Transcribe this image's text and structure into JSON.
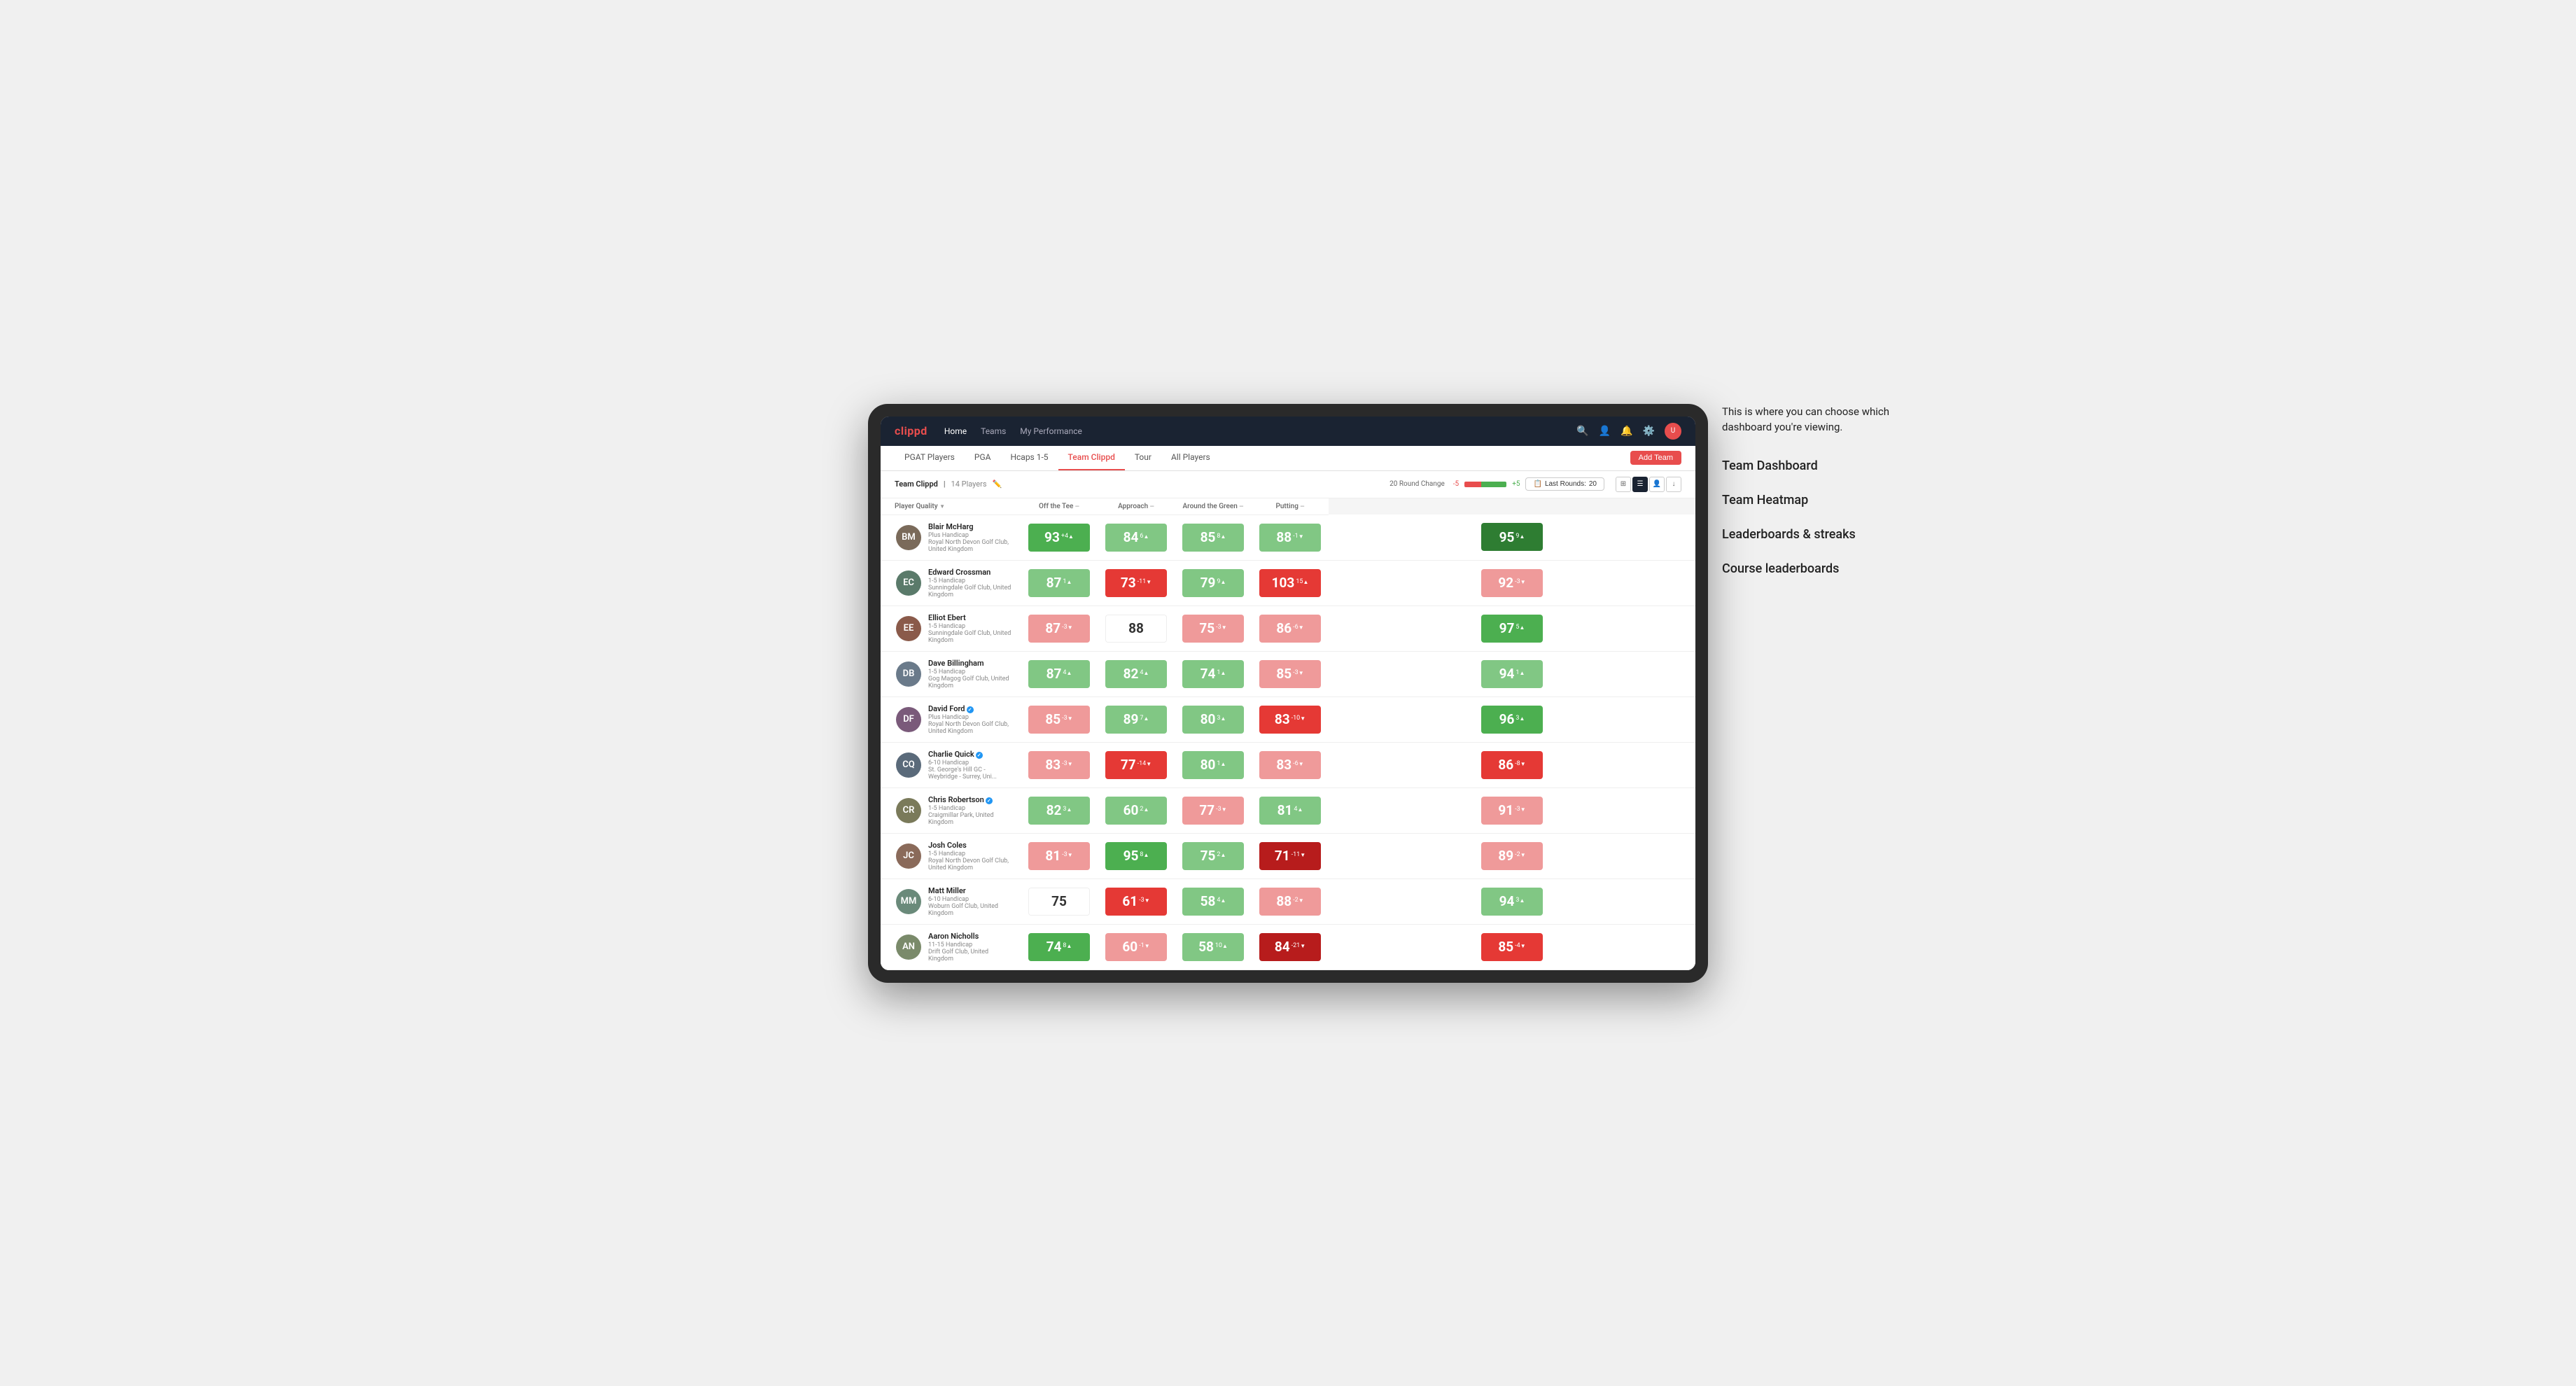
{
  "annotation": {
    "intro": "This is where you can choose which dashboard you're viewing.",
    "items": [
      "Team Dashboard",
      "Team Heatmap",
      "Leaderboards & streaks",
      "Course leaderboards"
    ]
  },
  "topnav": {
    "logo": "clippd",
    "links": [
      "Home",
      "Teams",
      "My Performance"
    ]
  },
  "subnav": {
    "links": [
      "PGAT Players",
      "PGA",
      "Hcaps 1-5",
      "Team Clippd",
      "Tour",
      "All Players"
    ],
    "active": "Team Clippd",
    "add_team_label": "Add Team"
  },
  "team_header": {
    "name": "Team Clippd",
    "count": "14 Players",
    "round_change_label": "20 Round Change",
    "rc_neg": "-5",
    "rc_pos": "+5",
    "last_rounds_label": "Last Rounds:",
    "last_rounds_value": "20"
  },
  "table": {
    "columns": [
      {
        "label": "Player Quality",
        "key": "player_quality"
      },
      {
        "label": "Off the Tee",
        "key": "off_tee"
      },
      {
        "label": "Approach",
        "key": "approach"
      },
      {
        "label": "Around the Green",
        "key": "around_green"
      },
      {
        "label": "Putting",
        "key": "putting"
      }
    ],
    "players": [
      {
        "name": "Blair McHarg",
        "handicap": "Plus Handicap",
        "club": "Royal North Devon Golf Club, United Kingdom",
        "initials": "BM",
        "avatar_color": "#7a6a5a",
        "player_quality": {
          "value": "93",
          "change": "+4",
          "dir": "up",
          "bg": "green-mid"
        },
        "off_tee": {
          "value": "84",
          "change": "6",
          "dir": "up",
          "bg": "green-light"
        },
        "approach": {
          "value": "85",
          "change": "8",
          "dir": "up",
          "bg": "green-light"
        },
        "around_green": {
          "value": "88",
          "change": "-1",
          "dir": "down",
          "bg": "green-light"
        },
        "putting": {
          "value": "95",
          "change": "9",
          "dir": "up",
          "bg": "green-dark"
        }
      },
      {
        "name": "Edward Crossman",
        "handicap": "1-5 Handicap",
        "club": "Sunningdale Golf Club, United Kingdom",
        "initials": "EC",
        "avatar_color": "#5a7a6a",
        "player_quality": {
          "value": "87",
          "change": "1",
          "dir": "up",
          "bg": "green-light"
        },
        "off_tee": {
          "value": "73",
          "change": "-11",
          "dir": "down",
          "bg": "red-mid"
        },
        "approach": {
          "value": "79",
          "change": "9",
          "dir": "up",
          "bg": "green-light"
        },
        "around_green": {
          "value": "103",
          "change": "15",
          "dir": "up",
          "bg": "red-mid"
        },
        "putting": {
          "value": "92",
          "change": "-3",
          "dir": "down",
          "bg": "red-light"
        }
      },
      {
        "name": "Elliot Ebert",
        "handicap": "1-5 Handicap",
        "club": "Sunningdale Golf Club, United Kingdom",
        "initials": "EE",
        "avatar_color": "#8a5a4a",
        "player_quality": {
          "value": "87",
          "change": "-3",
          "dir": "down",
          "bg": "red-light"
        },
        "off_tee": {
          "value": "88",
          "change": "",
          "dir": "",
          "bg": "white"
        },
        "approach": {
          "value": "75",
          "change": "-3",
          "dir": "down",
          "bg": "red-light"
        },
        "around_green": {
          "value": "86",
          "change": "-6",
          "dir": "down",
          "bg": "red-light"
        },
        "putting": {
          "value": "97",
          "change": "5",
          "dir": "up",
          "bg": "green-mid"
        }
      },
      {
        "name": "Dave Billingham",
        "handicap": "1-5 Handicap",
        "club": "Gog Magog Golf Club, United Kingdom",
        "initials": "DB",
        "avatar_color": "#6a7a8a",
        "player_quality": {
          "value": "87",
          "change": "4",
          "dir": "up",
          "bg": "green-light"
        },
        "off_tee": {
          "value": "82",
          "change": "4",
          "dir": "up",
          "bg": "green-light"
        },
        "approach": {
          "value": "74",
          "change": "1",
          "dir": "up",
          "bg": "green-light"
        },
        "around_green": {
          "value": "85",
          "change": "-3",
          "dir": "down",
          "bg": "red-light"
        },
        "putting": {
          "value": "94",
          "change": "1",
          "dir": "up",
          "bg": "green-light"
        }
      },
      {
        "name": "David Ford",
        "handicap": "Plus Handicap",
        "club": "Royal North Devon Golf Club, United Kingdom",
        "initials": "DF",
        "avatar_color": "#7a5a7a",
        "verified": true,
        "player_quality": {
          "value": "85",
          "change": "-3",
          "dir": "down",
          "bg": "red-light"
        },
        "off_tee": {
          "value": "89",
          "change": "7",
          "dir": "up",
          "bg": "green-light"
        },
        "approach": {
          "value": "80",
          "change": "3",
          "dir": "up",
          "bg": "green-light"
        },
        "around_green": {
          "value": "83",
          "change": "-10",
          "dir": "down",
          "bg": "red-mid"
        },
        "putting": {
          "value": "96",
          "change": "3",
          "dir": "up",
          "bg": "green-mid"
        }
      },
      {
        "name": "Charlie Quick",
        "handicap": "6-10 Handicap",
        "club": "St. George's Hill GC - Weybridge - Surrey, Uni...",
        "initials": "CQ",
        "avatar_color": "#5a6a7a",
        "verified": true,
        "player_quality": {
          "value": "83",
          "change": "-3",
          "dir": "down",
          "bg": "red-light"
        },
        "off_tee": {
          "value": "77",
          "change": "-14",
          "dir": "down",
          "bg": "red-mid"
        },
        "approach": {
          "value": "80",
          "change": "1",
          "dir": "up",
          "bg": "green-light"
        },
        "around_green": {
          "value": "83",
          "change": "-6",
          "dir": "down",
          "bg": "red-light"
        },
        "putting": {
          "value": "86",
          "change": "-8",
          "dir": "down",
          "bg": "red-mid"
        }
      },
      {
        "name": "Chris Robertson",
        "handicap": "1-5 Handicap",
        "club": "Craigmillar Park, United Kingdom",
        "initials": "CR",
        "avatar_color": "#7a7a5a",
        "verified": true,
        "player_quality": {
          "value": "82",
          "change": "3",
          "dir": "up",
          "bg": "green-light"
        },
        "off_tee": {
          "value": "60",
          "change": "2",
          "dir": "up",
          "bg": "green-light"
        },
        "approach": {
          "value": "77",
          "change": "-3",
          "dir": "down",
          "bg": "red-light"
        },
        "around_green": {
          "value": "81",
          "change": "4",
          "dir": "up",
          "bg": "green-light"
        },
        "putting": {
          "value": "91",
          "change": "-3",
          "dir": "down",
          "bg": "red-light"
        }
      },
      {
        "name": "Josh Coles",
        "handicap": "1-5 Handicap",
        "club": "Royal North Devon Golf Club, United Kingdom",
        "initials": "JC",
        "avatar_color": "#8a6a5a",
        "player_quality": {
          "value": "81",
          "change": "-3",
          "dir": "down",
          "bg": "red-light"
        },
        "off_tee": {
          "value": "95",
          "change": "8",
          "dir": "up",
          "bg": "green-mid"
        },
        "approach": {
          "value": "75",
          "change": "2",
          "dir": "up",
          "bg": "green-light"
        },
        "around_green": {
          "value": "71",
          "change": "-11",
          "dir": "down",
          "bg": "red-dark"
        },
        "putting": {
          "value": "89",
          "change": "-2",
          "dir": "down",
          "bg": "red-light"
        }
      },
      {
        "name": "Matt Miller",
        "handicap": "6-10 Handicap",
        "club": "Woburn Golf Club, United Kingdom",
        "initials": "MM",
        "avatar_color": "#6a8a7a",
        "player_quality": {
          "value": "75",
          "change": "",
          "dir": "",
          "bg": "white"
        },
        "off_tee": {
          "value": "61",
          "change": "-3",
          "dir": "down",
          "bg": "red-mid"
        },
        "approach": {
          "value": "58",
          "change": "4",
          "dir": "up",
          "bg": "green-light"
        },
        "around_green": {
          "value": "88",
          "change": "-2",
          "dir": "down",
          "bg": "red-light"
        },
        "putting": {
          "value": "94",
          "change": "3",
          "dir": "up",
          "bg": "green-light"
        }
      },
      {
        "name": "Aaron Nicholls",
        "handicap": "11-15 Handicap",
        "club": "Drift Golf Club, United Kingdom",
        "initials": "AN",
        "avatar_color": "#7a8a6a",
        "player_quality": {
          "value": "74",
          "change": "8",
          "dir": "up",
          "bg": "green-mid"
        },
        "off_tee": {
          "value": "60",
          "change": "-1",
          "dir": "down",
          "bg": "red-light"
        },
        "approach": {
          "value": "58",
          "change": "10",
          "dir": "up",
          "bg": "green-light"
        },
        "around_green": {
          "value": "84",
          "change": "-21",
          "dir": "down",
          "bg": "red-dark"
        },
        "putting": {
          "value": "85",
          "change": "-4",
          "dir": "down",
          "bg": "red-mid"
        }
      }
    ]
  }
}
